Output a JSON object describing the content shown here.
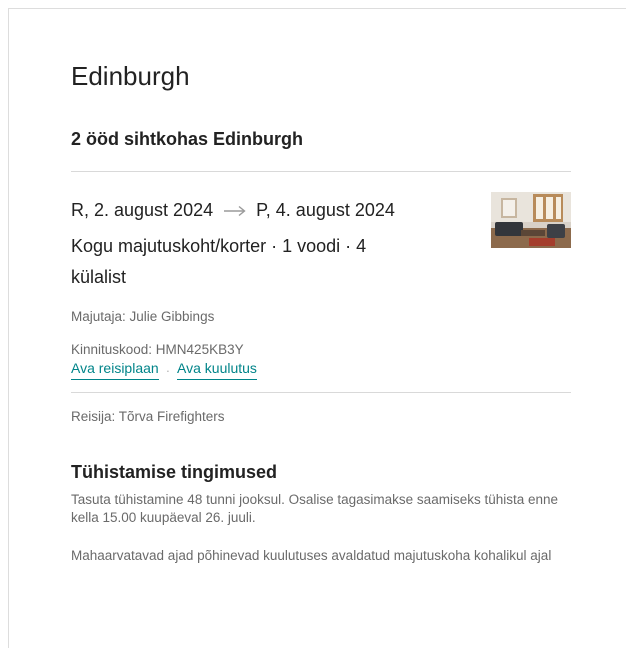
{
  "header": {
    "city": "Edinburgh",
    "nights_summary": "2 ööd sihtkohas Edinburgh"
  },
  "stay": {
    "check_in": "R, 2. august 2024",
    "check_out": "P, 4. august 2024",
    "listing_summary": "Kogu majutuskoht/korter · 1 voodi · 4 külalist",
    "host": "Majutaja: Julie Gibbings",
    "confirmation_code": "Kinnituskood: HMN425KB3Y",
    "thumbnail_icon": "listing-photo"
  },
  "links": {
    "itinerary": "Ava reisiplaan",
    "separator": "·",
    "listing": "Ava kuulutus"
  },
  "traveler": "Reisija: Tõrva Firefighters",
  "cancellation": {
    "title": "Tühistamise tingimused",
    "policy_text": "Tasuta tühistamine 48 tunni jooksul. Osalise tagasimakse saamiseks tühista enne kella 15.00 kuupäeval 26. juuli.",
    "timezone_note": "Mahaarvatavad ajad põhinevad kuulutuses avaldatud majutuskoha kohalikul ajal"
  },
  "colors": {
    "link": "#008489",
    "text_primary": "#222222",
    "text_secondary": "#6a6a6a",
    "divider": "#d9d9d9"
  }
}
